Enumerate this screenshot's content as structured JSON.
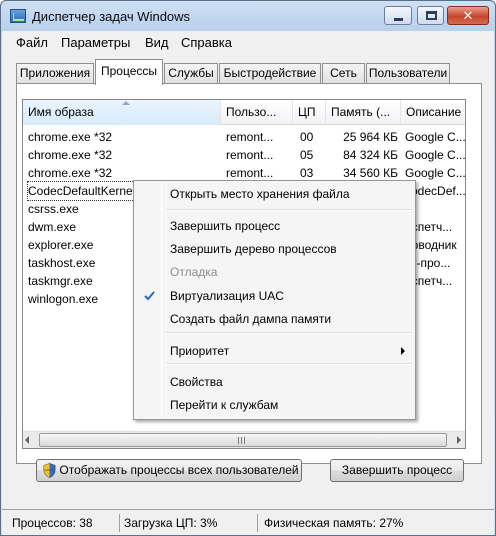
{
  "window": {
    "title": "Диспетчер задач Windows",
    "close_glyph": "✕"
  },
  "menu": [
    "Файл",
    "Параметры",
    "Вид",
    "Справка"
  ],
  "tabs": [
    {
      "label": "Приложения",
      "active": false
    },
    {
      "label": "Процессы",
      "active": true
    },
    {
      "label": "Службы",
      "active": false
    },
    {
      "label": "Быстродействие",
      "active": false
    },
    {
      "label": "Сеть",
      "active": false
    },
    {
      "label": "Пользователи",
      "active": false
    }
  ],
  "table": {
    "columns": [
      "Имя образа",
      "Пользо...",
      "ЦП",
      "Память (...",
      "Описание"
    ],
    "rows": [
      {
        "name": "chrome.exe *32",
        "user": "remont...",
        "cpu": "00",
        "mem": "25 964 КБ",
        "desc": "Google C..."
      },
      {
        "name": "chrome.exe *32",
        "user": "remont...",
        "cpu": "05",
        "mem": "84 324 КБ",
        "desc": "Google C..."
      },
      {
        "name": "chrome.exe *32",
        "user": "remont...",
        "cpu": "03",
        "mem": "34 560 КБ",
        "desc": "Google C..."
      },
      {
        "name": "CodecDefaultKernel.exe",
        "user": "",
        "cpu": "",
        "mem": "",
        "desc": "codecDef..."
      },
      {
        "name": "csrss.exe",
        "user": "",
        "cpu": "",
        "mem": "",
        "desc": ""
      },
      {
        "name": "dwm.exe",
        "user": "",
        "cpu": "",
        "mem": "",
        "desc": "испетч..."
      },
      {
        "name": "explorer.exe",
        "user": "",
        "cpu": "",
        "mem": "",
        "desc": "роводник"
      },
      {
        "name": "taskhost.exe",
        "user": "",
        "cpu": "",
        "mem": "",
        "desc": "ст-про..."
      },
      {
        "name": "taskmgr.exe",
        "user": "",
        "cpu": "",
        "mem": "",
        "desc": "испетч..."
      },
      {
        "name": "winlogon.exe",
        "user": "",
        "cpu": "",
        "mem": "",
        "desc": ""
      }
    ]
  },
  "context_menu": {
    "items": [
      {
        "label": "Открыть место хранения файла",
        "disabled": false,
        "checked": false,
        "submenu": false
      },
      {
        "label": "Завершить процесс",
        "disabled": false,
        "checked": false,
        "submenu": false
      },
      {
        "label": "Завершить дерево процессов",
        "disabled": false,
        "checked": false,
        "submenu": false
      },
      {
        "label": "Отладка",
        "disabled": true,
        "checked": false,
        "submenu": false
      },
      {
        "label": "Виртуализация UAC",
        "disabled": false,
        "checked": true,
        "submenu": false
      },
      {
        "label": "Создать файл дампа памяти",
        "disabled": false,
        "checked": false,
        "submenu": false
      },
      {
        "label": "Приоритет",
        "disabled": false,
        "checked": false,
        "submenu": true
      },
      {
        "label": "Свойства",
        "disabled": false,
        "checked": false,
        "submenu": false
      },
      {
        "label": "Перейти к службам",
        "disabled": false,
        "checked": false,
        "submenu": false
      }
    ]
  },
  "buttons": {
    "show_all": "Отображать процессы всех пользователей",
    "end_process": "Завершить процесс"
  },
  "status": {
    "processes": "Процессов: 38",
    "cpu": "Загрузка ЦП: 3%",
    "memory": "Физическая память: 27%"
  },
  "colors": {
    "accent_check": "#2a66c8",
    "close_red": "#c7452d"
  }
}
